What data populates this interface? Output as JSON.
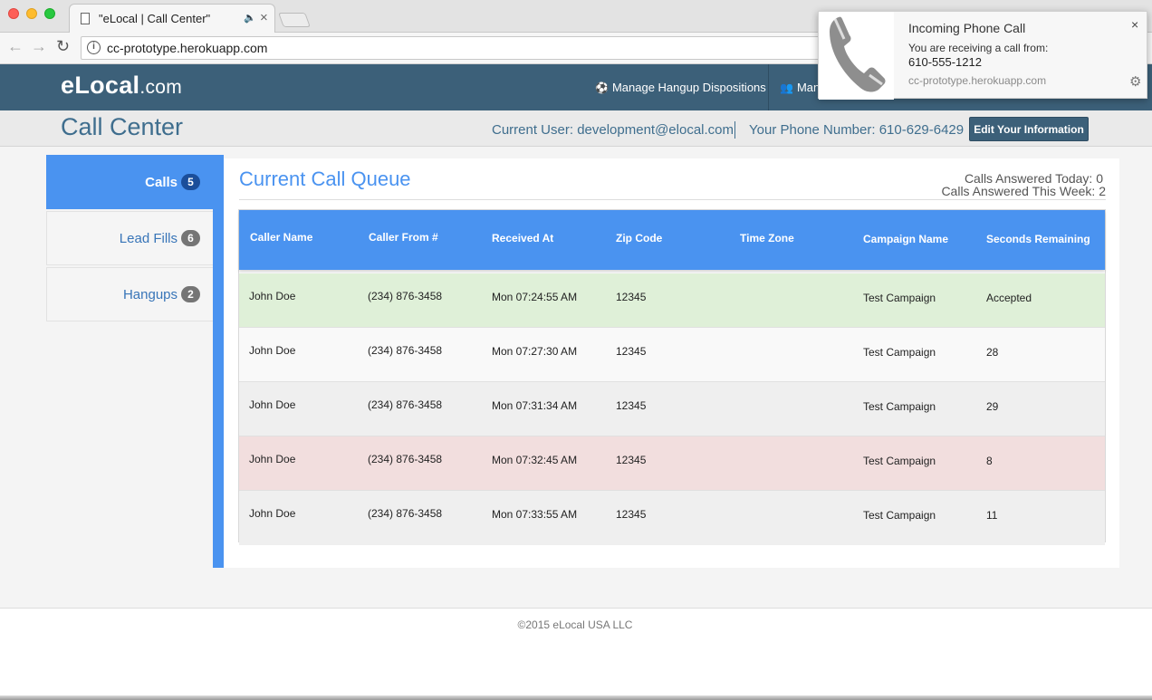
{
  "browser": {
    "tab_title": "\"eLocal | Call Center\"",
    "audio_glyph": "🔈",
    "close_glyph": "×",
    "url": "cc-prototype.herokuapp.com",
    "back_glyph": "←",
    "forward_glyph": "→",
    "reload_glyph": "↻",
    "info_glyph": "i"
  },
  "header": {
    "logo_main": "eLocal",
    "logo_suffix": ".com",
    "nav": [
      {
        "label": "Manage Hangup Dispositions",
        "icon": "soccer-ball-icon",
        "glyph": "⚽"
      },
      {
        "label": "Manage",
        "icon": "users-icon",
        "glyph": "👥"
      }
    ]
  },
  "subheader": {
    "title": "Call Center",
    "current_user": "Current User: development@elocal.com",
    "phone_number": "Your Phone Number: 610-629-6429",
    "edit_button": "Edit Your Information"
  },
  "sidebar": {
    "items": [
      {
        "label": "Calls",
        "count": "5",
        "active": true
      },
      {
        "label": "Lead Fills",
        "count": "6",
        "active": false
      },
      {
        "label": "Hangups",
        "count": "2",
        "active": false
      }
    ]
  },
  "queue": {
    "title": "Current Call Queue",
    "answered_today": "Calls Answered Today: 0",
    "answered_week": "Calls Answered This Week: 2",
    "columns": [
      "Caller Name",
      "Caller From #",
      "Received At",
      "Zip Code",
      "Time Zone",
      "Campaign Name",
      "Seconds Remaining"
    ],
    "rows": [
      {
        "name": "John Doe",
        "from": "(234) 876-3458",
        "received": "Mon 07:24:55 AM",
        "zip": "12345",
        "timezone": "",
        "campaign": "Test Campaign",
        "remaining": "Accepted",
        "state": "accepted",
        "color": "#dff0d8"
      },
      {
        "name": "John Doe",
        "from": "(234) 876-3458",
        "received": "Mon 07:27:30 AM",
        "zip": "12345",
        "timezone": "",
        "campaign": "Test Campaign",
        "remaining": "28",
        "state": "waiting",
        "color": "#f9f9f9"
      },
      {
        "name": "John Doe",
        "from": "(234) 876-3458",
        "received": "Mon 07:31:34 AM",
        "zip": "12345",
        "timezone": "",
        "campaign": "Test Campaign",
        "remaining": "29",
        "state": "waiting",
        "color": "#efefef"
      },
      {
        "name": "John Doe",
        "from": "(234) 876-3458",
        "received": "Mon 07:32:45 AM",
        "zip": "12345",
        "timezone": "",
        "campaign": "Test Campaign",
        "remaining": "8",
        "state": "urgent",
        "color": "#f2dede"
      },
      {
        "name": "John Doe",
        "from": "(234) 876-3458",
        "received": "Mon 07:33:55 AM",
        "zip": "12345",
        "timezone": "",
        "campaign": "Test Campaign",
        "remaining": "11",
        "state": "waiting",
        "color": "#efefef"
      }
    ]
  },
  "footer": {
    "copyright": "©2015 eLocal USA LLC"
  },
  "notification": {
    "title": "Incoming Phone Call",
    "body": "You are receiving a call from:",
    "number": "610-555-1212",
    "origin": "cc-prototype.herokuapp.com",
    "close_glyph": "×",
    "gear_glyph": "⚙"
  },
  "colors": {
    "header_bg": "#3c6079",
    "accent_blue": "#4a93f0",
    "accepted_row": "#dff0d8",
    "urgent_row": "#f2dede"
  }
}
